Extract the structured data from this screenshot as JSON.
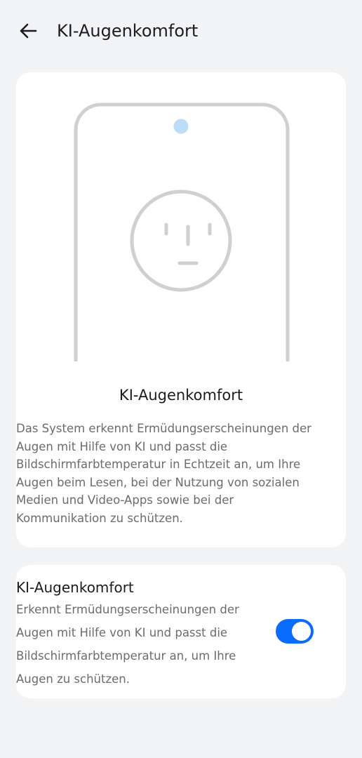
{
  "header": {
    "title": "KI-Augenkomfort",
    "back_icon": "arrow-left-icon"
  },
  "feature_card": {
    "illustration_icon": "phone-face-illustration",
    "title": "KI-Augenkomfort",
    "description": "Das System erkennt Ermüdungserscheinungen der Augen mit Hilfe von KI und passt die Bildschirmfarbtemperatur in Echtzeit an, um Ihre Augen beim Lesen, bei der Nutzung von sozialen Medien und Video-Apps sowie bei der Kommunikation zu schützen."
  },
  "setting": {
    "title": "KI-Augenkomfort",
    "description": "Erkennt Ermüdungserscheinungen der Augen mit Hilfe von KI und passt die Bildschirmfarbtemperatur an, um Ihre Augen zu schützen.",
    "enabled": true
  },
  "colors": {
    "background": "#f2f3f5",
    "card": "#ffffff",
    "accent": "#0a6bff",
    "illustration_stroke": "#cfcfd4",
    "camera_dot": "#bcdcf7"
  }
}
